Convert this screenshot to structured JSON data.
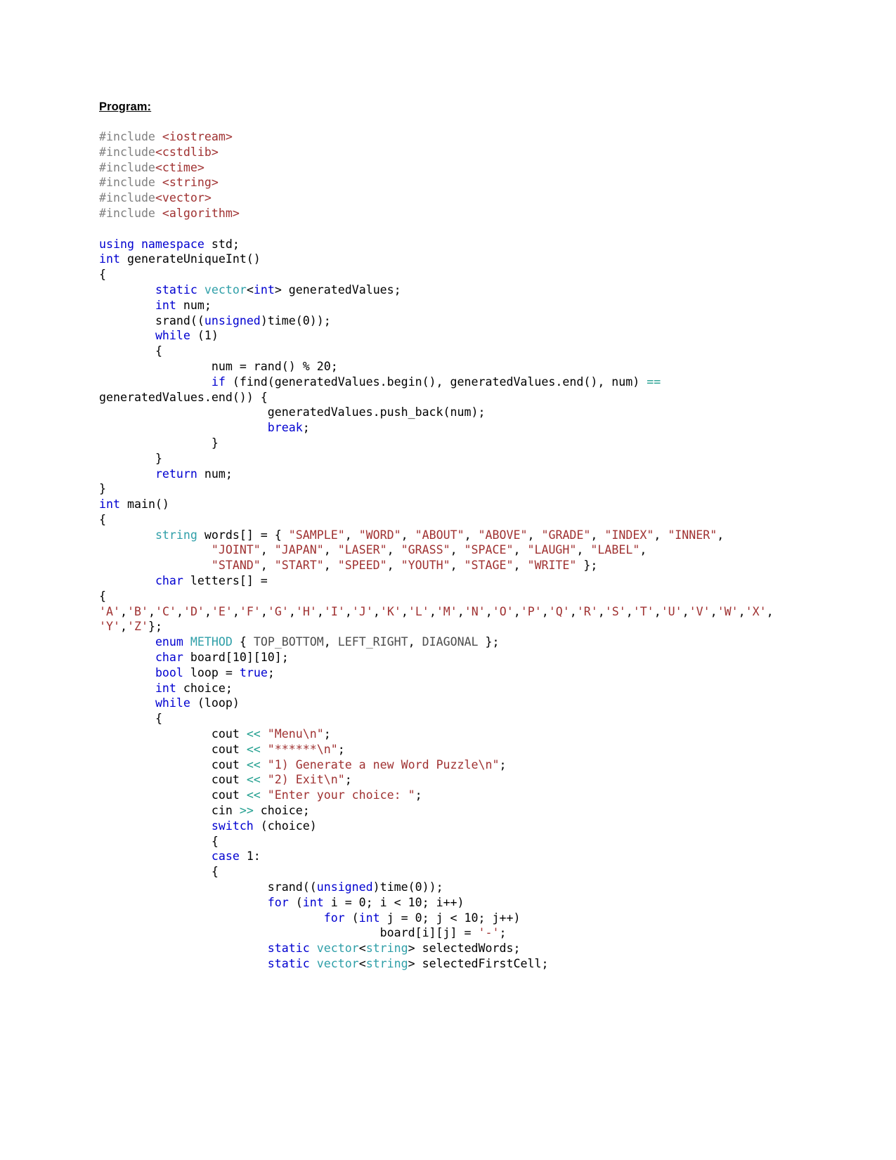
{
  "document": {
    "heading": "Program:",
    "language": "C++"
  },
  "colors": {
    "preprocessor": "#808080",
    "include_header": "#a03232",
    "keyword": "#0000d0",
    "type": "#2f9fa8",
    "string": "#a03232",
    "operator": "#1f9e8e",
    "enum_constant": "#4d4d4d",
    "plain": "#000000",
    "page_background": "#ffffff"
  },
  "code_lines": [
    [
      {
        "t": "#include ",
        "c": "pre"
      },
      {
        "t": "<iostream>",
        "c": "inc"
      }
    ],
    [
      {
        "t": "#include",
        "c": "pre"
      },
      {
        "t": "<cstdlib>",
        "c": "inc"
      }
    ],
    [
      {
        "t": "#include",
        "c": "pre"
      },
      {
        "t": "<ctime>",
        "c": "inc"
      }
    ],
    [
      {
        "t": "#include ",
        "c": "pre"
      },
      {
        "t": "<string>",
        "c": "inc"
      }
    ],
    [
      {
        "t": "#include",
        "c": "pre"
      },
      {
        "t": "<vector>",
        "c": "inc"
      }
    ],
    [
      {
        "t": "#include ",
        "c": "pre"
      },
      {
        "t": "<algorithm>",
        "c": "inc"
      }
    ],
    [],
    [
      {
        "t": "using namespace",
        "c": "kw"
      },
      {
        "t": " std;",
        "c": "plain"
      }
    ],
    [
      {
        "t": "int",
        "c": "kw"
      },
      {
        "t": " generateUniqueInt()",
        "c": "plain"
      }
    ],
    [
      {
        "t": "{",
        "c": "plain"
      }
    ],
    [
      {
        "t": "\t",
        "c": "plain"
      },
      {
        "t": "static",
        "c": "kw"
      },
      {
        "t": " ",
        "c": "plain"
      },
      {
        "t": "vector",
        "c": "type"
      },
      {
        "t": "<",
        "c": "plain"
      },
      {
        "t": "int",
        "c": "kw"
      },
      {
        "t": "> generatedValues;",
        "c": "plain"
      }
    ],
    [
      {
        "t": "\t",
        "c": "plain"
      },
      {
        "t": "int",
        "c": "kw"
      },
      {
        "t": " num;",
        "c": "plain"
      }
    ],
    [
      {
        "t": "\tsrand((",
        "c": "plain"
      },
      {
        "t": "unsigned",
        "c": "kw"
      },
      {
        "t": ")time(0));",
        "c": "plain"
      }
    ],
    [
      {
        "t": "\t",
        "c": "plain"
      },
      {
        "t": "while",
        "c": "kw"
      },
      {
        "t": " (1)",
        "c": "plain"
      }
    ],
    [
      {
        "t": "\t{",
        "c": "plain"
      }
    ],
    [
      {
        "t": "\t\tnum = rand() % 20;",
        "c": "plain"
      }
    ],
    [
      {
        "t": "\t\t",
        "c": "plain"
      },
      {
        "t": "if",
        "c": "kw"
      },
      {
        "t": " (find(generatedValues.begin(), generatedValues.end(), num) ",
        "c": "plain"
      },
      {
        "t": "==",
        "c": "op"
      },
      {
        "t": " generatedValues.end()) {",
        "c": "plain"
      }
    ],
    [
      {
        "t": "\t\t\tgeneratedValues.push_back(num);",
        "c": "plain"
      }
    ],
    [
      {
        "t": "\t\t\t",
        "c": "plain"
      },
      {
        "t": "break",
        "c": "kw"
      },
      {
        "t": ";",
        "c": "plain"
      }
    ],
    [
      {
        "t": "\t\t}",
        "c": "plain"
      }
    ],
    [
      {
        "t": "\t}",
        "c": "plain"
      }
    ],
    [
      {
        "t": "\t",
        "c": "plain"
      },
      {
        "t": "return",
        "c": "kw"
      },
      {
        "t": " num;",
        "c": "plain"
      }
    ],
    [
      {
        "t": "}",
        "c": "plain"
      }
    ],
    [
      {
        "t": "int",
        "c": "kw"
      },
      {
        "t": " main()",
        "c": "plain"
      }
    ],
    [
      {
        "t": "{",
        "c": "plain"
      }
    ],
    [
      {
        "t": "\t",
        "c": "plain"
      },
      {
        "t": "string",
        "c": "type"
      },
      {
        "t": " words[] = { ",
        "c": "plain"
      },
      {
        "t": "\"SAMPLE\"",
        "c": "str"
      },
      {
        "t": ", ",
        "c": "plain"
      },
      {
        "t": "\"WORD\"",
        "c": "str"
      },
      {
        "t": ", ",
        "c": "plain"
      },
      {
        "t": "\"ABOUT\"",
        "c": "str"
      },
      {
        "t": ", ",
        "c": "plain"
      },
      {
        "t": "\"ABOVE\"",
        "c": "str"
      },
      {
        "t": ", ",
        "c": "plain"
      },
      {
        "t": "\"GRADE\"",
        "c": "str"
      },
      {
        "t": ", ",
        "c": "plain"
      },
      {
        "t": "\"INDEX\"",
        "c": "str"
      },
      {
        "t": ", ",
        "c": "plain"
      },
      {
        "t": "\"INNER\"",
        "c": "str"
      },
      {
        "t": ",",
        "c": "plain"
      }
    ],
    [
      {
        "t": "\t\t",
        "c": "plain"
      },
      {
        "t": "\"JOINT\"",
        "c": "str"
      },
      {
        "t": ", ",
        "c": "plain"
      },
      {
        "t": "\"JAPAN\"",
        "c": "str"
      },
      {
        "t": ", ",
        "c": "plain"
      },
      {
        "t": "\"LASER\"",
        "c": "str"
      },
      {
        "t": ", ",
        "c": "plain"
      },
      {
        "t": "\"GRASS\"",
        "c": "str"
      },
      {
        "t": ", ",
        "c": "plain"
      },
      {
        "t": "\"SPACE\"",
        "c": "str"
      },
      {
        "t": ", ",
        "c": "plain"
      },
      {
        "t": "\"LAUGH\"",
        "c": "str"
      },
      {
        "t": ", ",
        "c": "plain"
      },
      {
        "t": "\"LABEL\"",
        "c": "str"
      },
      {
        "t": ",",
        "c": "plain"
      }
    ],
    [
      {
        "t": "\t\t",
        "c": "plain"
      },
      {
        "t": "\"STAND\"",
        "c": "str"
      },
      {
        "t": ", ",
        "c": "plain"
      },
      {
        "t": "\"START\"",
        "c": "str"
      },
      {
        "t": ", ",
        "c": "plain"
      },
      {
        "t": "\"SPEED\"",
        "c": "str"
      },
      {
        "t": ", ",
        "c": "plain"
      },
      {
        "t": "\"YOUTH\"",
        "c": "str"
      },
      {
        "t": ", ",
        "c": "plain"
      },
      {
        "t": "\"STAGE\"",
        "c": "str"
      },
      {
        "t": ", ",
        "c": "plain"
      },
      {
        "t": "\"WRITE\"",
        "c": "str"
      },
      {
        "t": " };",
        "c": "plain"
      }
    ],
    [
      {
        "t": "\t",
        "c": "plain"
      },
      {
        "t": "char",
        "c": "kw"
      },
      {
        "t": " letters[] =",
        "c": "plain"
      }
    ],
    [
      {
        "t": "{",
        "c": "plain"
      }
    ],
    [
      {
        "t": "'A'",
        "c": "str"
      },
      {
        "t": ",",
        "c": "plain"
      },
      {
        "t": "'B'",
        "c": "str"
      },
      {
        "t": ",",
        "c": "plain"
      },
      {
        "t": "'C'",
        "c": "str"
      },
      {
        "t": ",",
        "c": "plain"
      },
      {
        "t": "'D'",
        "c": "str"
      },
      {
        "t": ",",
        "c": "plain"
      },
      {
        "t": "'E'",
        "c": "str"
      },
      {
        "t": ",",
        "c": "plain"
      },
      {
        "t": "'F'",
        "c": "str"
      },
      {
        "t": ",",
        "c": "plain"
      },
      {
        "t": "'G'",
        "c": "str"
      },
      {
        "t": ",",
        "c": "plain"
      },
      {
        "t": "'H'",
        "c": "str"
      },
      {
        "t": ",",
        "c": "plain"
      },
      {
        "t": "'I'",
        "c": "str"
      },
      {
        "t": ",",
        "c": "plain"
      },
      {
        "t": "'J'",
        "c": "str"
      },
      {
        "t": ",",
        "c": "plain"
      },
      {
        "t": "'K'",
        "c": "str"
      },
      {
        "t": ",",
        "c": "plain"
      },
      {
        "t": "'L'",
        "c": "str"
      },
      {
        "t": ",",
        "c": "plain"
      },
      {
        "t": "'M'",
        "c": "str"
      },
      {
        "t": ",",
        "c": "plain"
      },
      {
        "t": "'N'",
        "c": "str"
      },
      {
        "t": ",",
        "c": "plain"
      },
      {
        "t": "'O'",
        "c": "str"
      },
      {
        "t": ",",
        "c": "plain"
      },
      {
        "t": "'P'",
        "c": "str"
      },
      {
        "t": ",",
        "c": "plain"
      },
      {
        "t": "'Q'",
        "c": "str"
      },
      {
        "t": ",",
        "c": "plain"
      },
      {
        "t": "'R'",
        "c": "str"
      },
      {
        "t": ",",
        "c": "plain"
      },
      {
        "t": "'S'",
        "c": "str"
      },
      {
        "t": ",",
        "c": "plain"
      },
      {
        "t": "'T'",
        "c": "str"
      },
      {
        "t": ",",
        "c": "plain"
      },
      {
        "t": "'U'",
        "c": "str"
      },
      {
        "t": ",",
        "c": "plain"
      },
      {
        "t": "'V'",
        "c": "str"
      },
      {
        "t": ",",
        "c": "plain"
      },
      {
        "t": "'W'",
        "c": "str"
      },
      {
        "t": ",",
        "c": "plain"
      },
      {
        "t": "'X'",
        "c": "str"
      },
      {
        "t": ",",
        "c": "plain"
      },
      {
        "t": "'Y'",
        "c": "str"
      },
      {
        "t": ",",
        "c": "plain"
      },
      {
        "t": "'Z'",
        "c": "str"
      },
      {
        "t": "};",
        "c": "plain"
      }
    ],
    [
      {
        "t": "\t",
        "c": "plain"
      },
      {
        "t": "enum",
        "c": "kw"
      },
      {
        "t": " ",
        "c": "plain"
      },
      {
        "t": "METHOD",
        "c": "type"
      },
      {
        "t": " { ",
        "c": "plain"
      },
      {
        "t": "TOP_BOTTOM",
        "c": "enum"
      },
      {
        "t": ", ",
        "c": "plain"
      },
      {
        "t": "LEFT_RIGHT",
        "c": "enum"
      },
      {
        "t": ", ",
        "c": "plain"
      },
      {
        "t": "DIAGONAL",
        "c": "enum"
      },
      {
        "t": " };",
        "c": "plain"
      }
    ],
    [
      {
        "t": "\t",
        "c": "plain"
      },
      {
        "t": "char",
        "c": "kw"
      },
      {
        "t": " board[10][10];",
        "c": "plain"
      }
    ],
    [
      {
        "t": "\t",
        "c": "plain"
      },
      {
        "t": "bool",
        "c": "kw"
      },
      {
        "t": " loop = ",
        "c": "plain"
      },
      {
        "t": "true",
        "c": "kw"
      },
      {
        "t": ";",
        "c": "plain"
      }
    ],
    [
      {
        "t": "\t",
        "c": "plain"
      },
      {
        "t": "int",
        "c": "kw"
      },
      {
        "t": " choice;",
        "c": "plain"
      }
    ],
    [
      {
        "t": "\t",
        "c": "plain"
      },
      {
        "t": "while",
        "c": "kw"
      },
      {
        "t": " (loop)",
        "c": "plain"
      }
    ],
    [
      {
        "t": "\t{",
        "c": "plain"
      }
    ],
    [
      {
        "t": "\t\tcout ",
        "c": "plain"
      },
      {
        "t": "<<",
        "c": "op"
      },
      {
        "t": " ",
        "c": "plain"
      },
      {
        "t": "\"Menu\\n\"",
        "c": "str"
      },
      {
        "t": ";",
        "c": "plain"
      }
    ],
    [
      {
        "t": "\t\tcout ",
        "c": "plain"
      },
      {
        "t": "<<",
        "c": "op"
      },
      {
        "t": " ",
        "c": "plain"
      },
      {
        "t": "\"******\\n\"",
        "c": "str"
      },
      {
        "t": ";",
        "c": "plain"
      }
    ],
    [
      {
        "t": "\t\tcout ",
        "c": "plain"
      },
      {
        "t": "<<",
        "c": "op"
      },
      {
        "t": " ",
        "c": "plain"
      },
      {
        "t": "\"1) Generate a new Word Puzzle\\n\"",
        "c": "str"
      },
      {
        "t": ";",
        "c": "plain"
      }
    ],
    [
      {
        "t": "\t\tcout ",
        "c": "plain"
      },
      {
        "t": "<<",
        "c": "op"
      },
      {
        "t": " ",
        "c": "plain"
      },
      {
        "t": "\"2) Exit\\n\"",
        "c": "str"
      },
      {
        "t": ";",
        "c": "plain"
      }
    ],
    [
      {
        "t": "\t\tcout ",
        "c": "plain"
      },
      {
        "t": "<<",
        "c": "op"
      },
      {
        "t": " ",
        "c": "plain"
      },
      {
        "t": "\"Enter your choice: \"",
        "c": "str"
      },
      {
        "t": ";",
        "c": "plain"
      }
    ],
    [
      {
        "t": "\t\tcin ",
        "c": "plain"
      },
      {
        "t": ">>",
        "c": "op"
      },
      {
        "t": " choice;",
        "c": "plain"
      }
    ],
    [
      {
        "t": "\t\t",
        "c": "plain"
      },
      {
        "t": "switch",
        "c": "kw"
      },
      {
        "t": " (choice)",
        "c": "plain"
      }
    ],
    [
      {
        "t": "\t\t{",
        "c": "plain"
      }
    ],
    [
      {
        "t": "\t\t",
        "c": "plain"
      },
      {
        "t": "case",
        "c": "kw"
      },
      {
        "t": " 1:",
        "c": "plain"
      }
    ],
    [
      {
        "t": "\t\t{",
        "c": "plain"
      }
    ],
    [
      {
        "t": "\t\t\tsrand((",
        "c": "plain"
      },
      {
        "t": "unsigned",
        "c": "kw"
      },
      {
        "t": ")time(0));",
        "c": "plain"
      }
    ],
    [
      {
        "t": "\t\t\t",
        "c": "plain"
      },
      {
        "t": "for",
        "c": "kw"
      },
      {
        "t": " (",
        "c": "plain"
      },
      {
        "t": "int",
        "c": "kw"
      },
      {
        "t": " i = 0; i < 10; i++)",
        "c": "plain"
      }
    ],
    [
      {
        "t": "\t\t\t\t",
        "c": "plain"
      },
      {
        "t": "for",
        "c": "kw"
      },
      {
        "t": " (",
        "c": "plain"
      },
      {
        "t": "int",
        "c": "kw"
      },
      {
        "t": " j = 0; j < 10; j++)",
        "c": "plain"
      }
    ],
    [
      {
        "t": "\t\t\t\t\tboard[i][j] = ",
        "c": "plain"
      },
      {
        "t": "'-'",
        "c": "str"
      },
      {
        "t": ";",
        "c": "plain"
      }
    ],
    [
      {
        "t": "\t\t\t",
        "c": "plain"
      },
      {
        "t": "static",
        "c": "kw"
      },
      {
        "t": " ",
        "c": "plain"
      },
      {
        "t": "vector",
        "c": "type"
      },
      {
        "t": "<",
        "c": "plain"
      },
      {
        "t": "string",
        "c": "type"
      },
      {
        "t": "> selectedWords;",
        "c": "plain"
      }
    ],
    [
      {
        "t": "\t\t\t",
        "c": "plain"
      },
      {
        "t": "static",
        "c": "kw"
      },
      {
        "t": " ",
        "c": "plain"
      },
      {
        "t": "vector",
        "c": "type"
      },
      {
        "t": "<",
        "c": "plain"
      },
      {
        "t": "string",
        "c": "type"
      },
      {
        "t": "> selectedFirstCell;",
        "c": "plain"
      }
    ]
  ]
}
